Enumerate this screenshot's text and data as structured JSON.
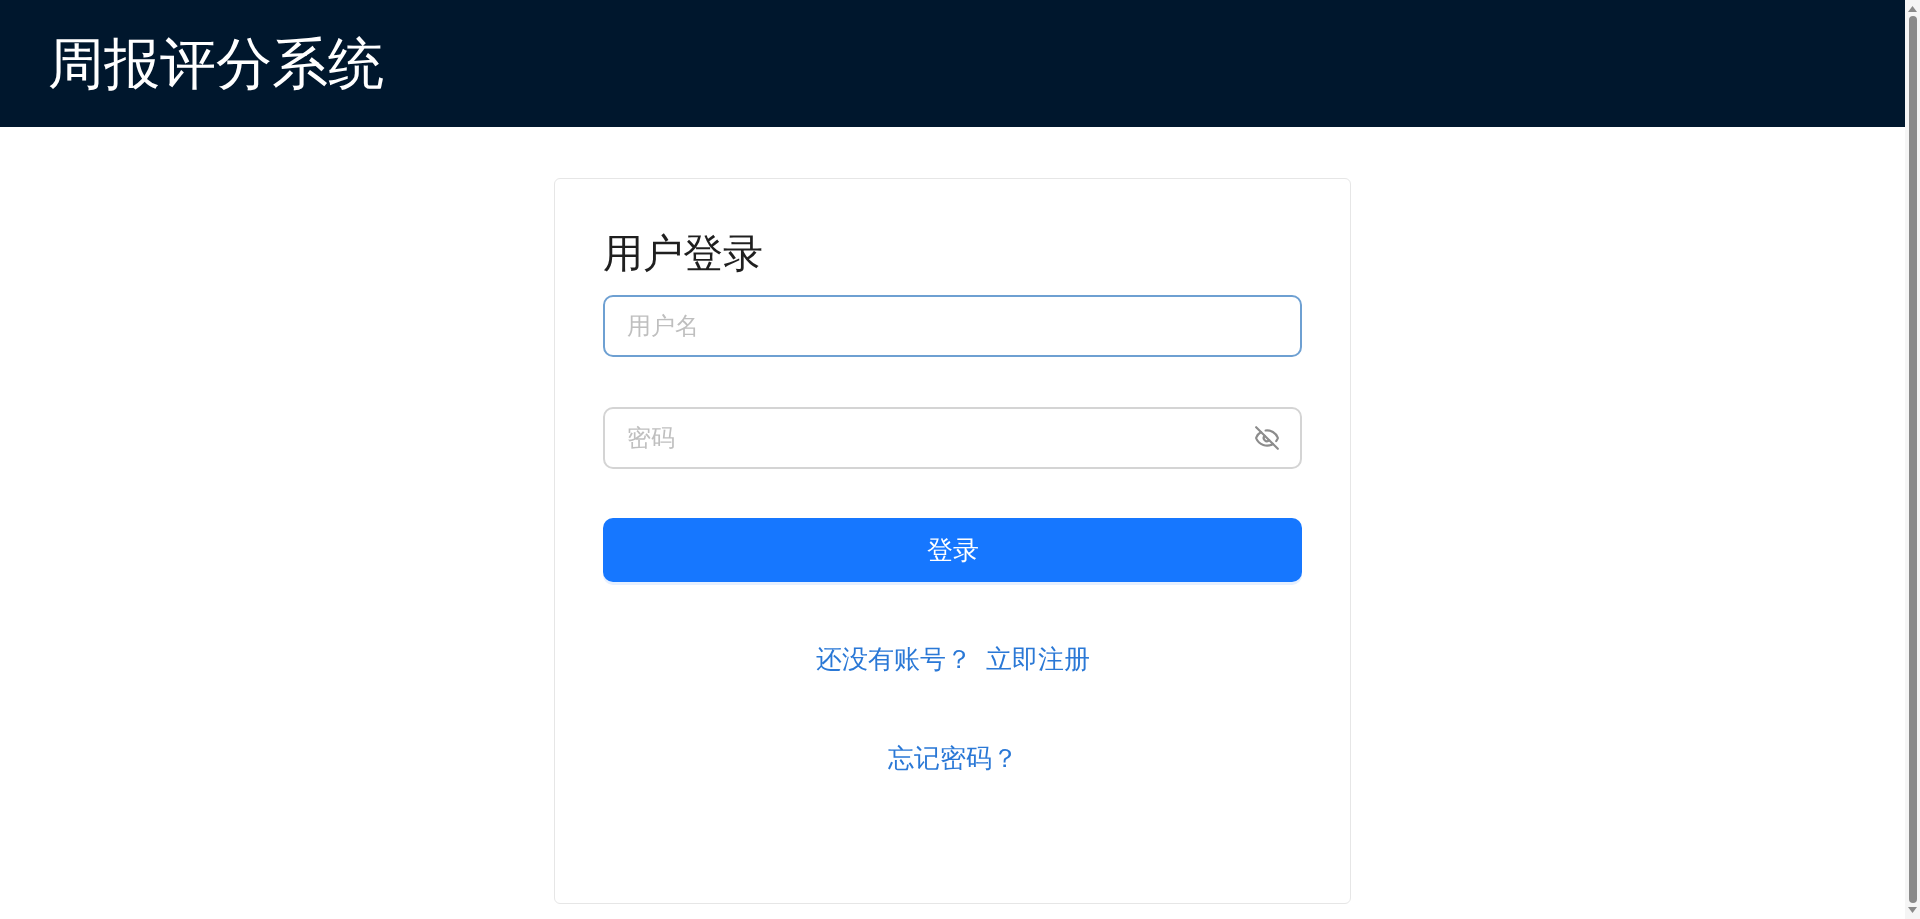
{
  "header": {
    "title": "周报评分系统"
  },
  "login": {
    "title": "用户登录",
    "fields": [
      {
        "kind": "text",
        "placeholder": "用户名",
        "focused": true
      },
      {
        "kind": "password",
        "placeholder": "密码",
        "focused": false
      }
    ],
    "submit": "登录",
    "register": {
      "prompt": "还没有账号？",
      "link": "立即注册"
    },
    "forgot": "忘记密码？"
  }
}
